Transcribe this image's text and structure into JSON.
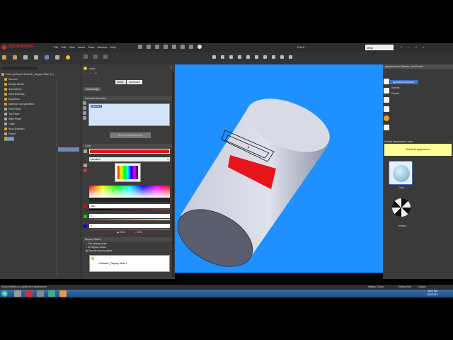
{
  "app": {
    "logo": "SOLIDWORKS",
    "title": "Part1 *",
    "menus": [
      "File",
      "Edit",
      "View",
      "Insert",
      "Tools",
      "Window",
      "Help"
    ],
    "search_value": "ramp"
  },
  "feature_tree": {
    "root": "Part1 (Default<<Default>_Display State 1>)",
    "items": [
      "Sensors",
      "Design Binder",
      "Annotations",
      "Solid Bodies(1)",
      "Equations",
      "Material <not specified>",
      "Front Plane",
      "Top Plane",
      "Right Plane",
      "Origin",
      "Boss-Extrude1",
      "Plane1",
      "Cut"
    ]
  },
  "property_manager": {
    "title": "color",
    "tabs": {
      "basic": "Basic",
      "advanced": "Advanced"
    },
    "subtab": "Color/Image",
    "selected_geometry": {
      "header": "Selected Geometry",
      "item": "Face<1>",
      "remove_button": "Remove Appearances"
    },
    "color": {
      "header": "Color",
      "swatch": "#e8141c",
      "mode": "standard",
      "values": [
        "255",
        "0",
        "0"
      ],
      "rgb_label": "RGB",
      "hsv_label": "HSV"
    },
    "display_states": {
      "header": "Display States",
      "options": [
        "This display state",
        "All display states",
        "Specify display states"
      ],
      "list_item": "<Default>_Display State 1"
    }
  },
  "task_pane": {
    "header": "Appearances, Scenes, and Decals",
    "tree": [
      "Appearances(color)",
      "Scenes",
      "Decals"
    ],
    "section_label": "Default Appearance: color",
    "hint": "Select an appearance",
    "thumbnails": [
      {
        "label": "Color"
      },
      {
        "label": "texture"
      }
    ]
  },
  "status": {
    "left": "Select entities to modify their appearance",
    "radius": "Radius: 25mm",
    "mode": "Editing Part",
    "units": "Custom"
  },
  "taskbar": {
    "time": "8:22 PM",
    "date": "16/2/2013"
  },
  "colors": {
    "viewport": "#1e90ff",
    "accent": "#e8141c",
    "hint_bg": "#ffff99"
  }
}
